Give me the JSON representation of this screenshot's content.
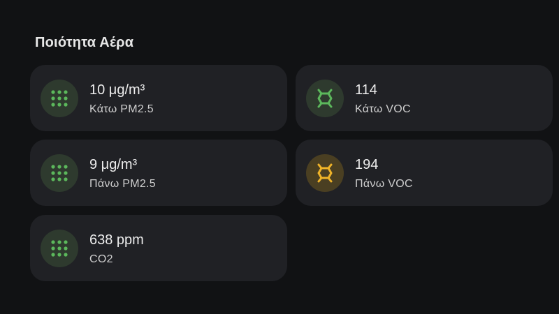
{
  "section": {
    "title": "Ποιότητα Αέρα"
  },
  "colors": {
    "background": "#111214",
    "card": "#202125",
    "good_icon": "#5cb85c",
    "good_bg": "#2e3a2e",
    "warn_icon": "#f0b429",
    "warn_bg": "#4a3f22"
  },
  "cards": [
    {
      "value": "10 μg/m³",
      "label": "Κάτω PM2.5",
      "icon": "dots-grid-icon",
      "status": "good"
    },
    {
      "value": "114",
      "label": "Κάτω VOC",
      "icon": "molecule-icon",
      "status": "good"
    },
    {
      "value": "9 μg/m³",
      "label": "Πάνω PM2.5",
      "icon": "dots-grid-icon",
      "status": "good"
    },
    {
      "value": "194",
      "label": "Πάνω VOC",
      "icon": "molecule-icon",
      "status": "warn"
    },
    {
      "value": "638 ppm",
      "label": "CO2",
      "icon": "dots-grid-icon",
      "status": "good"
    }
  ]
}
